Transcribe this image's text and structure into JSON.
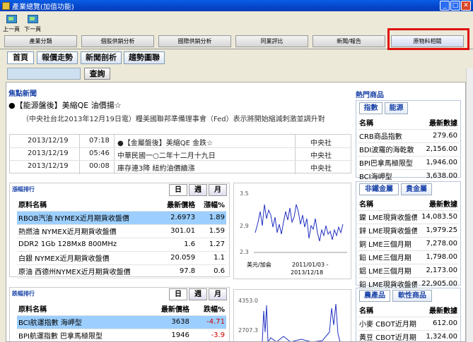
{
  "window": {
    "title": "產業總覽(加值功能)"
  },
  "toolbar": {
    "prev": "上一頁",
    "next": "下一頁"
  },
  "main_tabs": [
    "產業分類",
    "個股供銷分析",
    "國際供銷分析",
    "同業評比",
    "新聞/報告",
    "原物料相關"
  ],
  "sub_tabs": [
    "首頁",
    "報價走勢",
    "新聞剖析",
    "趨勢圖聯"
  ],
  "search": {
    "button": "查詢",
    "value": ""
  },
  "focus_news": {
    "title": "焦點新聞",
    "headline": "●【能源盤後】美縮QE 油價揚☆",
    "summary": "（中央社台北2013年12月19日電）糧美國聯邦準備理事會（Fed）表示將開始縮減刺激並調升對",
    "items": [
      {
        "date": "2013/12/19",
        "time": "07:18",
        "title": "●【金屬盤後】美縮QE 金跌☆",
        "src": "中央社"
      },
      {
        "date": "2013/12/19",
        "time": "05:46",
        "title": "中華民國一○二年十二月十九日",
        "src": "中央社"
      },
      {
        "date": "2013/12/19",
        "time": "00:08",
        "title": "庫存連3降 紐約油價續漲",
        "src": "中央社"
      }
    ]
  },
  "gainers": {
    "title": "漲幅排行",
    "tabs": [
      "日",
      "週",
      "月"
    ],
    "headers": [
      "原料名稱",
      "最新價格",
      "漲幅%"
    ],
    "rows": [
      {
        "name": "RBOB汽油 NYMEX近月期貨收盤價",
        "price": "2.6973",
        "chg": "1.89"
      },
      {
        "name": "熱燃油 NYMEX近月期貨收盤價",
        "price": "301.01",
        "chg": "1.59"
      },
      {
        "name": "DDR2 1Gb 128Mx8 800MHz",
        "price": "1.6",
        "chg": "1.27"
      },
      {
        "name": "白銀 NYMEX近月期貨收盤價",
        "price": "20.059",
        "chg": "1.1"
      },
      {
        "name": "原油 西德州NYMEX近月期貨收盤價",
        "price": "97.8",
        "chg": "0.6"
      }
    ],
    "chart": {
      "y_ticks": [
        "3.5",
        "2.9",
        "2.3"
      ],
      "unit": "美元/加侖",
      "range_line1": "2011/01/03 -",
      "range_line2": "2013/12/18"
    }
  },
  "losers": {
    "title": "跌幅排行",
    "tabs": [
      "日",
      "週",
      "月"
    ],
    "headers": [
      "原料名稱",
      "最新價格",
      "跌幅%"
    ],
    "rows": [
      {
        "name": "BCI航運指數 海岬型",
        "price": "3638",
        "chg": "-4.71"
      },
      {
        "name": "BPI航運指數 巴拿馬極限型",
        "price": "1946",
        "chg": "-3.9"
      }
    ],
    "chart": {
      "y_ticks": [
        "4353.0",
        "2707.3"
      ]
    }
  },
  "hot": {
    "title": "熱門商品",
    "group1": {
      "tabs": [
        "指數",
        "能源"
      ],
      "headers": [
        "名稱",
        "最新數據"
      ],
      "rows": [
        [
          "CRB商品指數",
          "279.60"
        ],
        [
          "BDI波羅的海乾散",
          "2,156.00"
        ],
        [
          "BPI巴拿馬極限型",
          "1,946.00"
        ],
        [
          "BCI海岬型",
          "3,638.00"
        ]
      ]
    },
    "group2": {
      "tabs": [
        "非鐵金屬",
        "貴金屬"
      ],
      "headers": [
        "名稱",
        "最新數據"
      ],
      "rows": [
        [
          "鎳 LME現貨收盤價",
          "14,083.50"
        ],
        [
          "鋅 LME現貨收盤價",
          "1,979.25"
        ],
        [
          "銅 LME三個月期",
          "7,278.00"
        ],
        [
          "鉛 LME三個月期",
          "1,798.00"
        ],
        [
          "鋁 LME三個月期",
          "2,173.00"
        ],
        [
          "鉛 LME現貨收盤價",
          "22,905.00"
        ]
      ]
    },
    "group3": {
      "tabs": [
        "農產品",
        "軟性商品"
      ],
      "headers": [
        "名稱",
        "最新數據"
      ],
      "rows": [
        [
          "小麥 CBOT近月期",
          "612.00"
        ],
        [
          "黃豆 CBOT近月期",
          "1,324.00"
        ]
      ]
    }
  },
  "colors": {
    "accent": "#1c45a8",
    "selected_row": "#9ccfff",
    "highlight_box": "#e01010",
    "title_bar": "#0a5ee5"
  }
}
